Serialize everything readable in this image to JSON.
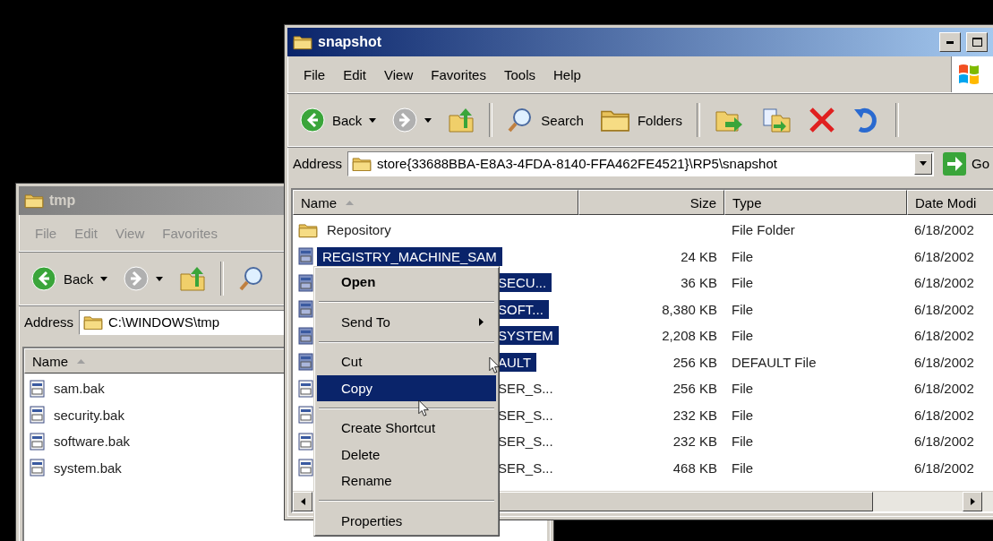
{
  "windows": [
    {
      "title": "tmp",
      "active": false,
      "menu": [
        "File",
        "Edit",
        "View",
        "Favorites"
      ],
      "toolbar": [
        {
          "kind": "back",
          "label": "Back"
        },
        {
          "kind": "forward"
        },
        {
          "kind": "up"
        },
        {
          "kind": "separator"
        },
        {
          "kind": "search"
        }
      ],
      "address": {
        "label": "Address",
        "value": "C:\\WINDOWS\\tmp"
      },
      "columns": [
        {
          "label": "Name",
          "sorted": true
        }
      ],
      "rows": [
        {
          "kind": "file",
          "selected": false,
          "name": "sam.bak"
        },
        {
          "kind": "file",
          "selected": false,
          "name": "security.bak"
        },
        {
          "kind": "file",
          "selected": false,
          "name": "software.bak"
        },
        {
          "kind": "file",
          "selected": false,
          "name": "system.bak"
        }
      ]
    },
    {
      "title": "snapshot",
      "active": true,
      "menu": [
        "File",
        "Edit",
        "View",
        "Favorites",
        "Tools",
        "Help"
      ],
      "toolbar": [
        {
          "kind": "back",
          "label": "Back"
        },
        {
          "kind": "forward"
        },
        {
          "kind": "up"
        },
        {
          "kind": "separator"
        },
        {
          "kind": "search",
          "label": "Search"
        },
        {
          "kind": "folders",
          "label": "Folders"
        },
        {
          "kind": "separator"
        },
        {
          "kind": "move"
        },
        {
          "kind": "copy"
        },
        {
          "kind": "delete"
        },
        {
          "kind": "undo"
        },
        {
          "kind": "separator"
        }
      ],
      "address": {
        "label": "Address",
        "value": "store{33688BBA-E8A3-4FDA-8140-FFA462FE4521}\\RP5\\snapshot",
        "go": "Go"
      },
      "columns": [
        {
          "label": "Name",
          "sorted": true
        },
        {
          "label": "Size",
          "sorted": false
        },
        {
          "label": "Type",
          "sorted": false
        },
        {
          "label": "Date Modi",
          "sorted": false
        }
      ],
      "rows": [
        {
          "kind": "folder",
          "selected": false,
          "name": "Repository",
          "type": "File Folder",
          "date": "6/18/2002"
        },
        {
          "kind": "file",
          "selected": true,
          "name": "REGISTRY_MACHINE_SAM",
          "size": "24 KB",
          "type": "File",
          "date": "6/18/2002"
        },
        {
          "kind": "file-covered",
          "selected": true,
          "name": "SECU...",
          "size": "36 KB",
          "type": "File",
          "date": "6/18/2002"
        },
        {
          "kind": "file-covered",
          "selected": true,
          "name": "SOFT...",
          "size": "8,380 KB",
          "type": "File",
          "date": "6/18/2002"
        },
        {
          "kind": "file-covered",
          "selected": true,
          "name": "SYSTEM",
          "size": "2,208 KB",
          "type": "File",
          "date": "6/18/2002"
        },
        {
          "kind": "file-covered",
          "selected": true,
          "name": "AULT",
          "size": "256 KB",
          "type": "DEFAULT File",
          "date": "6/18/2002"
        },
        {
          "kind": "file-covered",
          "selected": false,
          "name": "SER_S...",
          "size": "256 KB",
          "type": "File",
          "date": "6/18/2002"
        },
        {
          "kind": "file-covered",
          "selected": false,
          "name": "SER_S...",
          "size": "232 KB",
          "type": "File",
          "date": "6/18/2002"
        },
        {
          "kind": "file-covered",
          "selected": false,
          "name": "SER_S...",
          "size": "232 KB",
          "type": "File",
          "date": "6/18/2002"
        },
        {
          "kind": "file-covered",
          "selected": false,
          "name": "SER_S...",
          "size": "468 KB",
          "type": "File",
          "date": "6/18/2002"
        }
      ]
    }
  ],
  "context_menu": [
    {
      "kind": "item",
      "label": "Open",
      "default": true,
      "selected": false
    },
    {
      "kind": "separator"
    },
    {
      "kind": "submenu",
      "label": "Send To",
      "default": false,
      "selected": false
    },
    {
      "kind": "separator"
    },
    {
      "kind": "item",
      "label": "Cut",
      "default": false,
      "selected": false
    },
    {
      "kind": "item",
      "label": "Copy",
      "default": false,
      "selected": true
    },
    {
      "kind": "separator"
    },
    {
      "kind": "item",
      "label": "Create Shortcut",
      "default": false,
      "selected": false
    },
    {
      "kind": "item",
      "label": "Delete",
      "default": false,
      "selected": false
    },
    {
      "kind": "item",
      "label": "Rename",
      "default": false,
      "selected": false
    },
    {
      "kind": "separator"
    },
    {
      "kind": "item",
      "label": "Properties",
      "default": false,
      "selected": false
    }
  ]
}
